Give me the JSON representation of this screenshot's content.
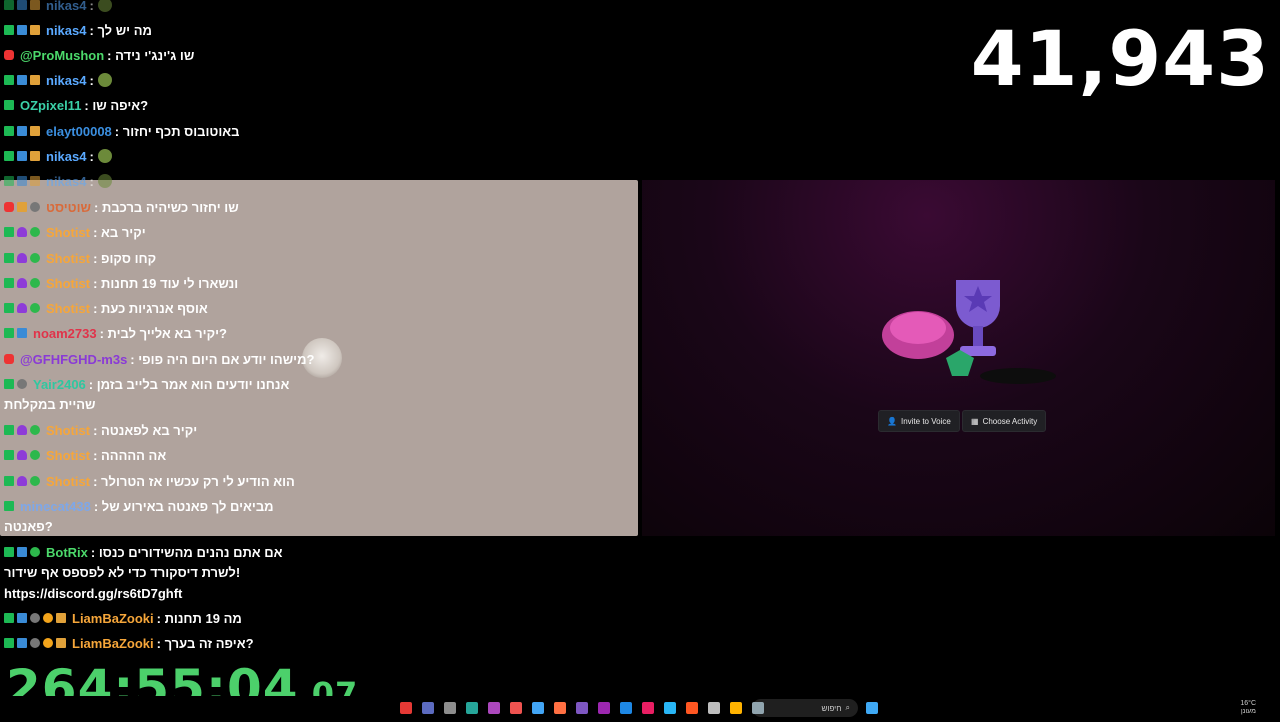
{
  "viewer_count": "41,943",
  "timer": {
    "main": "264:55:04",
    "fraction": ".07"
  },
  "chat_top": [
    {
      "user": "nikas4",
      "user_color": "#5aa9ff",
      "msg": ":",
      "emote": true,
      "badges": [
        "k",
        "blue",
        "gold"
      ],
      "dim": true
    },
    {
      "user": "nikas4",
      "user_color": "#5aa9ff",
      "msg": ": מה יש לך",
      "badges": [
        "k",
        "blue",
        "gold"
      ]
    },
    {
      "user": "@ProMushon",
      "user_color": "#4cd96b",
      "msg": ": שו ג'ינג'י נידה",
      "badges": [
        "red"
      ]
    },
    {
      "user": "nikas4",
      "user_color": "#5aa9ff",
      "msg": ":",
      "emote": true,
      "badges": [
        "k",
        "blue",
        "gold"
      ]
    },
    {
      "user": "OZpixel11",
      "user_color": "#3bd1a8",
      "msg": ": איפה שו?",
      "badges": [
        "k"
      ]
    },
    {
      "user": "elayt00008",
      "user_color": "#3b8fe0",
      "msg": ": באוטובוס תכף יחזור",
      "badges": [
        "k",
        "blue",
        "gold"
      ]
    },
    {
      "user": "nikas4",
      "user_color": "#5aa9ff",
      "msg": ":",
      "emote": true,
      "badges": [
        "k",
        "blue",
        "gold"
      ]
    },
    {
      "user": "nikas4",
      "user_color": "#5aa9ff",
      "msg": ":",
      "emote": true,
      "badges": [
        "k",
        "blue",
        "gold"
      ],
      "dim": true
    }
  ],
  "chat_overlay": [
    {
      "user": "שוטיסט",
      "user_color": "#d96a3a",
      "msg": ": שו יחזור כשיהיה ברכבת",
      "badges": [
        "red",
        "gold",
        "grey"
      ]
    },
    {
      "user": "Shotist",
      "user_color": "#f6a63a",
      "msg": ": יקיר בא",
      "badges": [
        "k",
        "purple",
        "green"
      ]
    },
    {
      "user": "Shotist",
      "user_color": "#f6a63a",
      "msg": ": קחו סקופ",
      "badges": [
        "k",
        "purple",
        "green"
      ]
    },
    {
      "user": "Shotist",
      "user_color": "#f6a63a",
      "msg": ": ונשארו לי עוד 19 תחנות",
      "badges": [
        "k",
        "purple",
        "green"
      ]
    },
    {
      "user": "Shotist",
      "user_color": "#f6a63a",
      "msg": ": אוסף אנרגיות כעת",
      "badges": [
        "k",
        "purple",
        "green"
      ]
    },
    {
      "user": "noam2733",
      "user_color": "#e0334a",
      "msg": ": יקיר בא אלייך לבית?",
      "badges": [
        "k",
        "blue"
      ]
    },
    {
      "user": "@GFHFGHD-m3s",
      "user_color": "#8a3ad6",
      "msg": ": מישהו יודע אם היום היה פופי?",
      "badges": [
        "red"
      ]
    },
    {
      "user": "Yair2406",
      "user_color": "#2fc7a0",
      "msg": ": אנחנו יודעים הוא אמר בלייב בזמן",
      "badges": [
        "k",
        "grey"
      ]
    },
    {
      "user": "Shotist",
      "user_color": "#f6a63a",
      "msg": ": יקיר בא לפאנטה",
      "badges": [
        "k",
        "purple",
        "green"
      ]
    },
    {
      "user": "Shotist",
      "user_color": "#f6a63a",
      "msg": ": אה ההההה",
      "badges": [
        "k",
        "purple",
        "green"
      ]
    },
    {
      "user": "Shotist",
      "user_color": "#f6a63a",
      "msg": ": הוא הודיע לי רק עכשיו אז הטרולר",
      "badges": [
        "k",
        "purple",
        "green"
      ]
    },
    {
      "user": "minecat438",
      "user_color": "#7ea7e8",
      "msg": ": מביאים לך פאנטה באירוע של",
      "badges": [
        "k"
      ]
    }
  ],
  "wrap_texts": {
    "yair_cont": "שהיית במקלחת",
    "minecat_cont": "פאנטה?"
  },
  "chat_bottom": [
    {
      "user": "BotRix",
      "user_color": "#4cd96b",
      "msg": ": אם אתם נהנים מהשידורים כנסו",
      "badges": [
        "k",
        "blue",
        "green"
      ]
    },
    {
      "user": "LiamBaZooki",
      "user_color": "#f6a63a",
      "msg": ": מה 19 תחנות",
      "badges": [
        "k",
        "blue",
        "grey",
        "orange",
        "gold"
      ]
    },
    {
      "user": "LiamBaZooki",
      "user_color": "#f6a63a",
      "msg": ": איפה זה בערך?",
      "badges": [
        "k",
        "blue",
        "grey",
        "orange",
        "gold"
      ]
    }
  ],
  "botrix_cont": [
    "לשרת דיסקורד כדי לא לפספס אף שידור!",
    "https://discord.gg/rs6tD7ghft"
  ],
  "discord": {
    "invite_label": "Invite to Voice",
    "activity_label": "Choose Activity"
  },
  "taskbar": {
    "search_label": "חיפוש",
    "weather_temp": "16°C",
    "weather_desc": "מעונן"
  },
  "colors": {
    "timer": "#4cd06b",
    "overlay_bg": "#b0a39d"
  }
}
